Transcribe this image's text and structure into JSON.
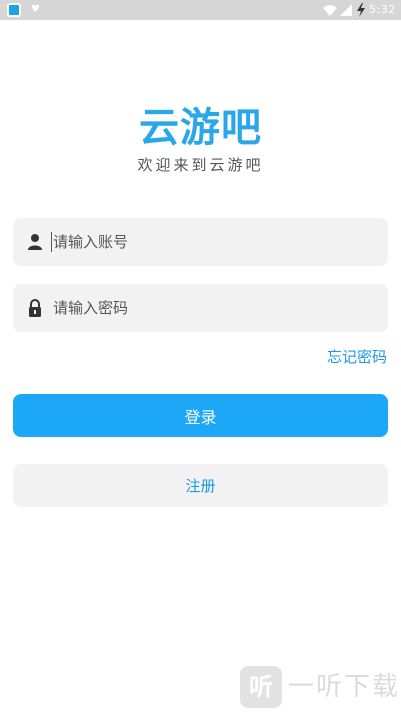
{
  "status_bar": {
    "time": "5:32",
    "icons": [
      "app-icon",
      "notification-icon",
      "wifi-icon",
      "signal-icon",
      "charging-icon"
    ]
  },
  "logo": {
    "title": "云游吧",
    "subtitle": "欢迎来到云游吧"
  },
  "form": {
    "account_placeholder": "请输入账号",
    "account_value": "",
    "account_icon": "user-icon",
    "password_placeholder": "请输入密码",
    "password_value": "",
    "password_icon": "lock-icon",
    "forgot_password": "忘记密码",
    "login_label": "登录",
    "register_label": "注册"
  },
  "watermark": {
    "logo_text": "听",
    "text": "一听下载"
  },
  "colors": {
    "accent": "#1da7f7",
    "link": "#1a9ae0",
    "logo": "#2aa6ea",
    "field_bg": "#f2f2f2",
    "status_bar_bg": "#d6d6d6"
  }
}
